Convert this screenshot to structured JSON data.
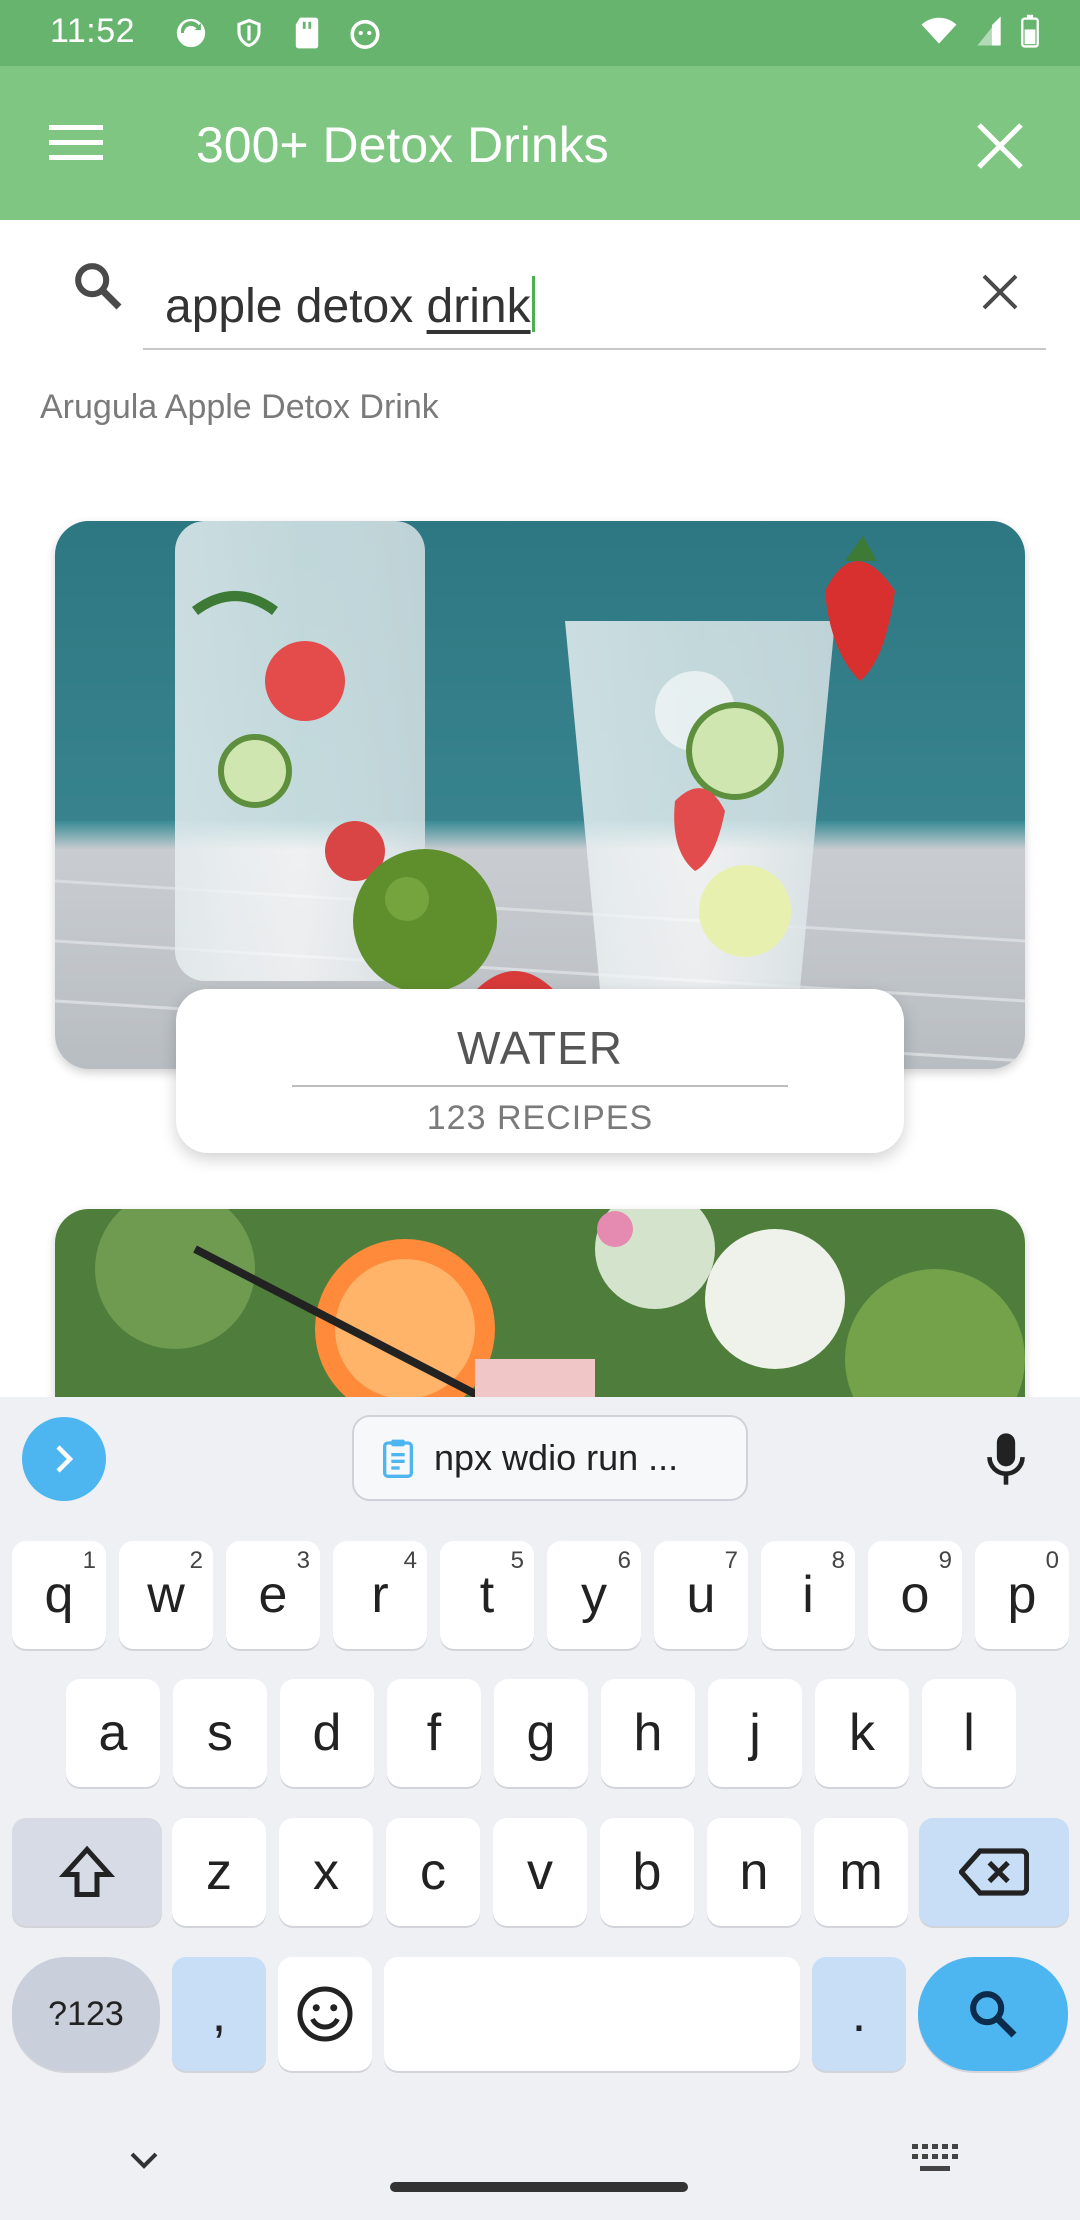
{
  "status_bar": {
    "time": "11:52"
  },
  "app_bar": {
    "title": "300+ Detox Drinks"
  },
  "search": {
    "value_prefix": "apple detox ",
    "value_underlined": "drink"
  },
  "suggestion": {
    "text": "Arugula Apple Detox Drink"
  },
  "cards": [
    {
      "title": "WATER",
      "subtitle": "123 RECIPES"
    }
  ],
  "keyboard": {
    "clipboard_text": "npx wdio run ...",
    "rows": {
      "row1": [
        {
          "label": "q",
          "hint": "1"
        },
        {
          "label": "w",
          "hint": "2"
        },
        {
          "label": "e",
          "hint": "3"
        },
        {
          "label": "r",
          "hint": "4"
        },
        {
          "label": "t",
          "hint": "5"
        },
        {
          "label": "y",
          "hint": "6"
        },
        {
          "label": "u",
          "hint": "7"
        },
        {
          "label": "i",
          "hint": "8"
        },
        {
          "label": "o",
          "hint": "9"
        },
        {
          "label": "p",
          "hint": "0"
        }
      ],
      "row2": [
        "a",
        "s",
        "d",
        "f",
        "g",
        "h",
        "j",
        "k",
        "l"
      ],
      "row3": [
        "z",
        "x",
        "c",
        "v",
        "b",
        "n",
        "m"
      ],
      "row4": {
        "symbols": "?123",
        "comma": ",",
        "period": "."
      }
    }
  },
  "colors": {
    "status_bar": "#66b46d",
    "app_bar": "#7ec682",
    "caret": "#4caf50",
    "keyboard_accent": "#4db6f0"
  }
}
